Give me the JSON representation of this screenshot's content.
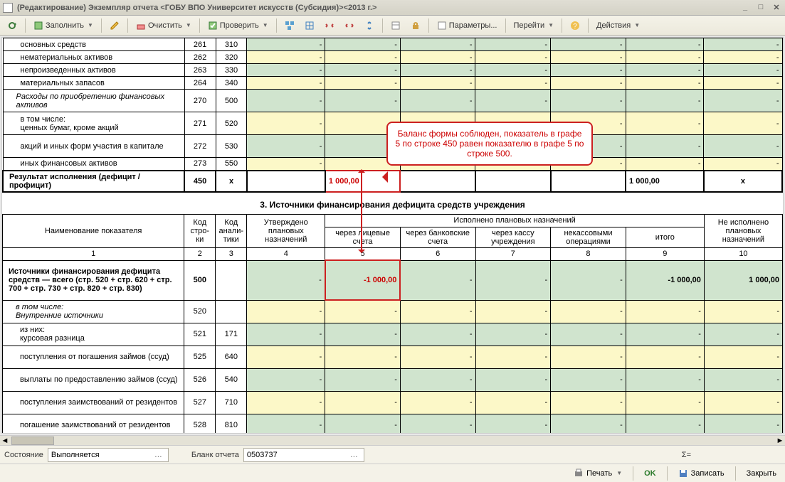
{
  "title": "(Редактирование) Экземпляр отчета <ГОБУ ВПО Университет искусств (Субсидия)><2013 г.>",
  "toolbar": {
    "fill": "Заполнить",
    "clear": "Очистить",
    "check": "Проверить",
    "params": "Параметры...",
    "goto": "Перейти",
    "actions": "Действия"
  },
  "callout": "Баланс формы соблюден, показатель в графе 5 по строке 450 равен показателю в графе 5 по строке 500.",
  "section3": "3. Источники финансирования дефицита средств учреждения",
  "headers": {
    "name": "Наименование показателя",
    "rowcode": "Код стро-ки",
    "anal": "Код анали-тики",
    "approved": "Утверждено плановых назначений",
    "executed": "Исполнено плановых назначений",
    "col5": "через лицевые счета",
    "col6": "через банковские счета",
    "col7": "через кассу учреждения",
    "col8": "некассовыми операциями",
    "col9": "итого",
    "col10": "Не исполнено плановых назначений",
    "n1": "1",
    "n2": "2",
    "n3": "3",
    "n4": "4",
    "n5": "5",
    "n6": "6",
    "n7": "7",
    "n8": "8",
    "n9": "9",
    "n10": "10"
  },
  "rows1": [
    {
      "name": "основных средств",
      "c2": "261",
      "c3": "310",
      "cls": "row-green indent2"
    },
    {
      "name": "нематериальных активов",
      "c2": "262",
      "c3": "320",
      "cls": "row-yellow indent2"
    },
    {
      "name": "непроизведенных активов",
      "c2": "263",
      "c3": "330",
      "cls": "row-green indent2"
    },
    {
      "name": "материальных запасов",
      "c2": "264",
      "c3": "340",
      "cls": "row-yellow indent2"
    },
    {
      "name": "Расходы по приобретению финансовых активов",
      "c2": "270",
      "c3": "500",
      "cls": "row-green indent1",
      "tall": true
    },
    {
      "name": "в том числе:\nценных бумаг, кроме акций",
      "c2": "271",
      "c3": "520",
      "cls": "row-yellow indent2",
      "tall": true
    },
    {
      "name": "акций и иных форм участия в капитале",
      "c2": "272",
      "c3": "530",
      "cls": "row-green indent2",
      "tall": true
    },
    {
      "name": "иных финансовых активов",
      "c2": "273",
      "c3": "550",
      "cls": "row-yellow indent2"
    }
  ],
  "result_row": {
    "name": "Результат исполнения (дефицит / профицит)",
    "c2": "450",
    "c3": "x",
    "c5": "1 000,00",
    "c9": "1 000,00",
    "c10": "x"
  },
  "rows2": [
    {
      "name": "Источники финансирования дефицита средств — всего (стр. 520 + стр. 620 + стр. 700 + стр. 730 + стр. 820 + стр. 830)",
      "c2": "500",
      "c5": "-1 000,00",
      "c9": "-1 000,00",
      "c10": "1 000,00",
      "cls": "row-green bold indent0",
      "tall3": true,
      "hl": true
    },
    {
      "name": "в том числе:\nВнутренние источники",
      "c2": "520",
      "cls": "row-yellow ital indent1",
      "tall": true
    },
    {
      "name": "из них:\nкурсовая разница",
      "c2": "521",
      "c3": "171",
      "cls": "row-green indent2",
      "tall": true
    },
    {
      "name": "поступления от погашения займов (ссуд)",
      "c2": "525",
      "c3": "640",
      "cls": "row-yellow indent2",
      "tall": true
    },
    {
      "name": "выплаты по предоставлению займов (ссуд)",
      "c2": "526",
      "c3": "540",
      "cls": "row-green indent2",
      "tall": true
    },
    {
      "name": "поступления заимствований от резидентов",
      "c2": "527",
      "c3": "710",
      "cls": "row-yellow indent2",
      "tall": true
    },
    {
      "name": "погашение заимствований от резидентов",
      "c2": "528",
      "c3": "810",
      "cls": "row-green indent2",
      "tall": true
    }
  ],
  "status": {
    "state_label": "Состояние",
    "state_value": "Выполняется",
    "form_label": "Бланк отчета",
    "form_value": "0503737",
    "sum": "Σ="
  },
  "bottom": {
    "print": "Печать",
    "ok": "OK",
    "save": "Записать",
    "close": "Закрыть"
  }
}
